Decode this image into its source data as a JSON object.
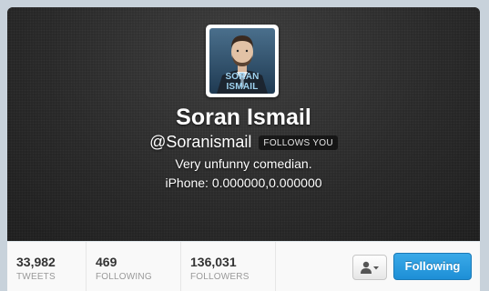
{
  "profile": {
    "full_name": "Soran Ismail",
    "screen_name": "@Soranismail",
    "follows_you_badge": "FOLLOWS YOU",
    "bio": "Very unfunny comedian.",
    "location": "iPhone: 0.000000,0.000000",
    "avatar_stamp": "SORAN ISMAIL"
  },
  "stats": {
    "tweets": {
      "value": "33,982",
      "label": "TWEETS"
    },
    "following": {
      "value": "469",
      "label": "FOLLOWING"
    },
    "followers": {
      "value": "136,031",
      "label": "FOLLOWERS"
    }
  },
  "actions": {
    "follow_button_label": "Following",
    "user_dropdown_icon": "user-icon"
  },
  "colors": {
    "accent": "#2b9be0",
    "header_bg": "#2a2a2a",
    "stats_bg": "#f9f9f9"
  }
}
